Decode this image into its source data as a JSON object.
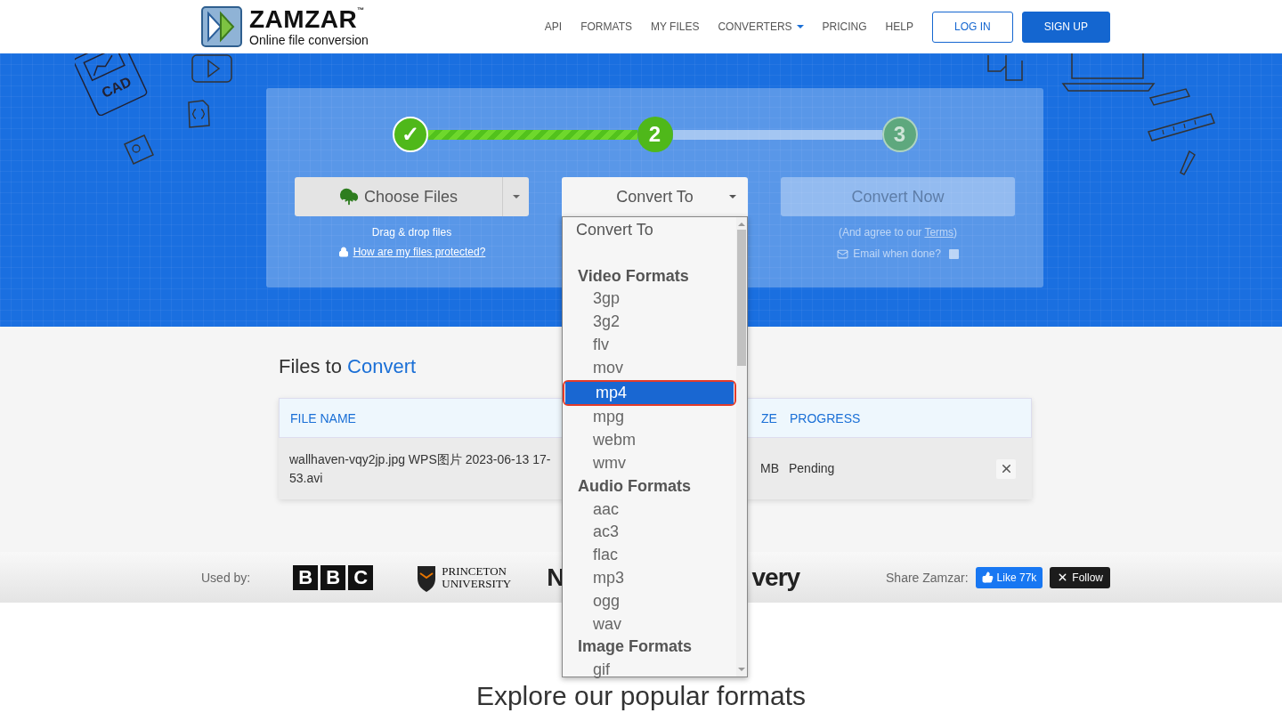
{
  "header": {
    "logo": {
      "name": "ZAMZAR",
      "mark": "™",
      "tagline": "Online file conversion"
    },
    "nav": [
      {
        "label": "API",
        "has_menu": false
      },
      {
        "label": "FORMATS",
        "has_menu": false
      },
      {
        "label": "MY FILES",
        "has_menu": false
      },
      {
        "label": "CONVERTERS",
        "has_menu": true
      },
      {
        "label": "PRICING",
        "has_menu": false
      },
      {
        "label": "HELP",
        "has_menu": false
      }
    ],
    "buttons": [
      {
        "label": "LOG IN",
        "kind": "outline"
      },
      {
        "label": "SIGN UP",
        "kind": "filled"
      }
    ]
  },
  "hero": {
    "doodle_label": "CAD",
    "steps": [
      {
        "label": "✓",
        "completed": true,
        "active": false
      },
      {
        "label": "2",
        "completed": false,
        "active": true
      },
      {
        "label": "3",
        "completed": false,
        "active": false
      }
    ],
    "choose_files": {
      "label": "Choose Files",
      "hint": "Drag & drop files",
      "link": "How are my files protected?"
    },
    "convert_to": {
      "label": "Convert To",
      "menu": {
        "expanded": true,
        "items": [
          {
            "kind": "option",
            "label": "Convert To",
            "selected": false
          },
          {
            "kind": "blank"
          },
          {
            "kind": "group",
            "label": "Video Formats"
          },
          {
            "kind": "option",
            "label": "3gp",
            "selected": false
          },
          {
            "kind": "option",
            "label": "3g2",
            "selected": false
          },
          {
            "kind": "option",
            "label": "flv",
            "selected": false
          },
          {
            "kind": "option",
            "label": "mov",
            "selected": false
          },
          {
            "kind": "option",
            "label": "mp4",
            "selected": true
          },
          {
            "kind": "option",
            "label": "mpg",
            "selected": false
          },
          {
            "kind": "option",
            "label": "webm",
            "selected": false
          },
          {
            "kind": "option",
            "label": "wmv",
            "selected": false
          },
          {
            "kind": "group",
            "label": "Audio Formats"
          },
          {
            "kind": "option",
            "label": "aac",
            "selected": false
          },
          {
            "kind": "option",
            "label": "ac3",
            "selected": false
          },
          {
            "kind": "option",
            "label": "flac",
            "selected": false
          },
          {
            "kind": "option",
            "label": "mp3",
            "selected": false
          },
          {
            "kind": "option",
            "label": "ogg",
            "selected": false
          },
          {
            "kind": "option",
            "label": "wav",
            "selected": false
          },
          {
            "kind": "group",
            "label": "Image Formats"
          },
          {
            "kind": "option",
            "label": "gif",
            "selected": false
          }
        ]
      }
    },
    "convert_now": {
      "label": "Convert Now",
      "disabled": true,
      "note_before": "(And agree to our ",
      "note_link": "Terms",
      "note_after": ")",
      "email_label": "Email when done?",
      "email_checked": false
    }
  },
  "files": {
    "title": "Files to",
    "title_accent": "Convert",
    "columns": [
      "FILE NAME",
      "ZE",
      "PROGRESS"
    ],
    "rows": [
      {
        "file_name": [
          "wallhaven-vqy2jp.jpg WPS图片 2023-06-13 17-",
          "53.avi"
        ],
        "size": "MB",
        "progress": "Pending"
      }
    ]
  },
  "used_by": {
    "label": "Used by:",
    "logos": [
      {
        "kind": "boxed",
        "text": "B B C"
      },
      {
        "kind": "shield",
        "lines": [
          "PRINCETON",
          "UNIVERSITY"
        ]
      },
      {
        "kind": "heavy",
        "text": "N"
      },
      {
        "kind": "heavy",
        "text": "very"
      }
    ],
    "share_label": "Share Zamzar:",
    "like": "Like 77k",
    "follow": "Follow"
  },
  "explore": {
    "title": "Explore our popular formats"
  }
}
